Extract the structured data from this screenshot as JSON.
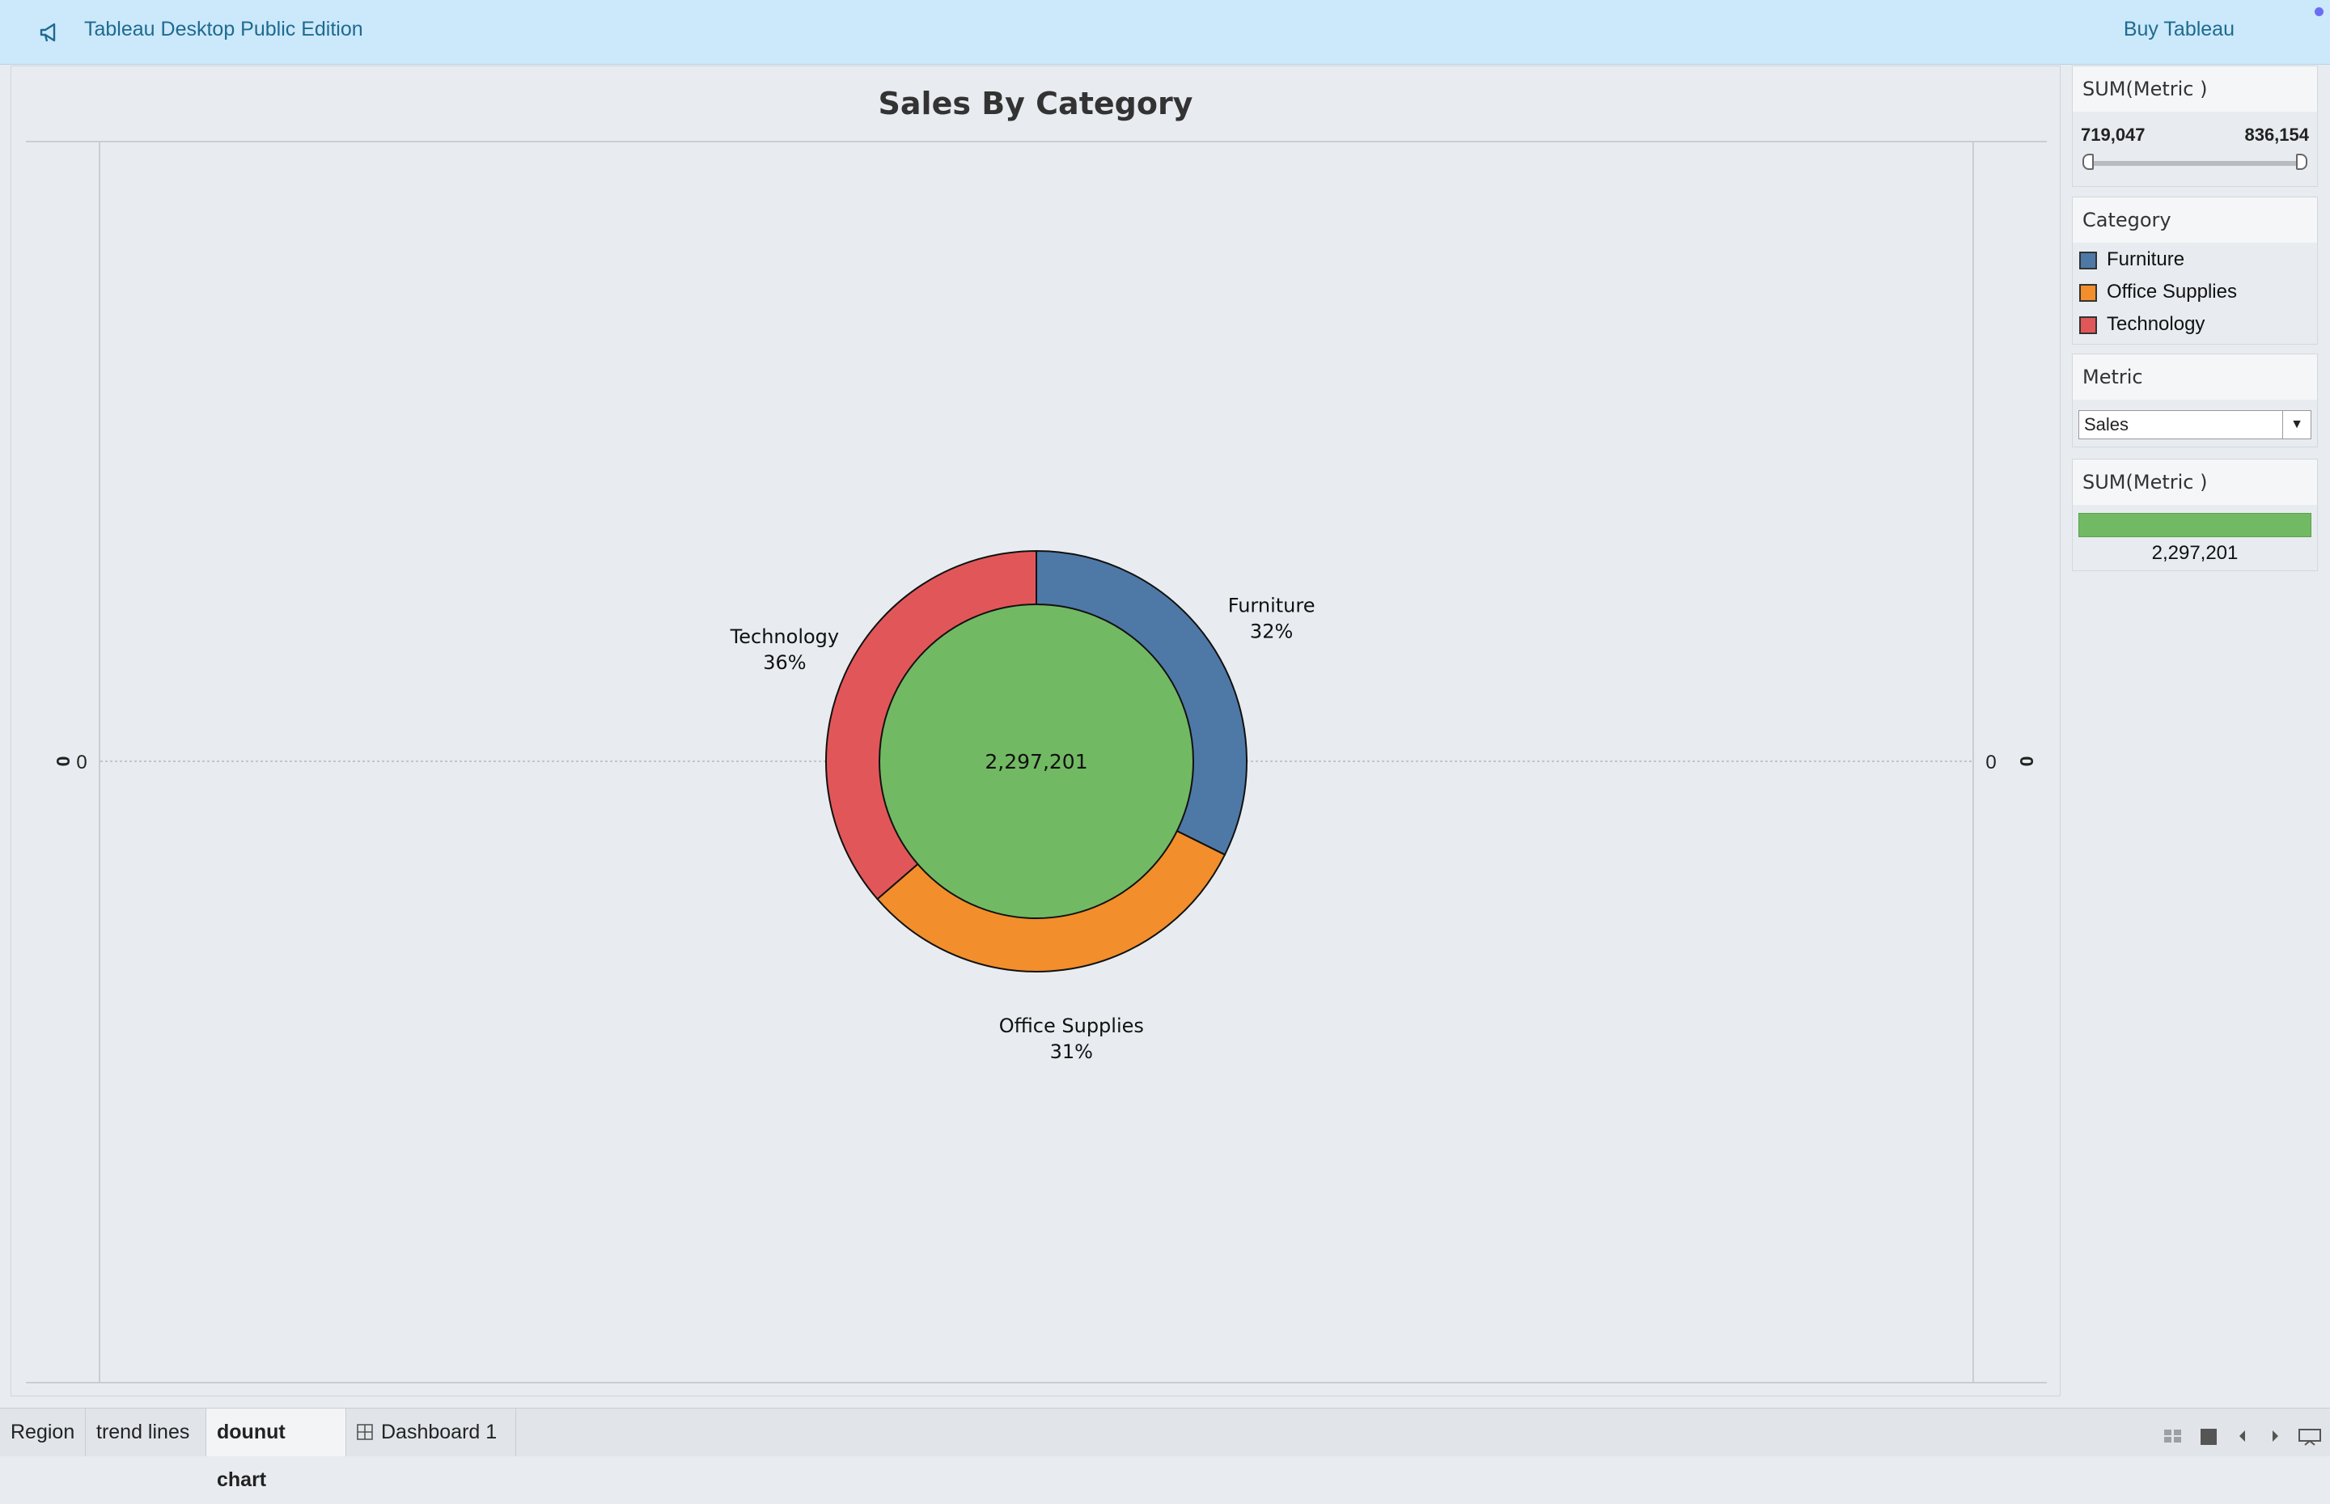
{
  "banner": {
    "app_title": "Tableau Desktop Public Edition",
    "buy_label": "Buy Tableau",
    "icon": "megaphone-icon"
  },
  "chart_title": "Sales By Category",
  "axis_labels": {
    "left_rot": "0",
    "left_val": "0",
    "right_val": "0",
    "right_rot": "0"
  },
  "chart_data": {
    "type": "pie",
    "title": "Sales By Category",
    "total_label": "2,297,201",
    "categories": [
      "Furniture",
      "Office Supplies",
      "Technology"
    ],
    "values": [
      32,
      31,
      36
    ],
    "percent_labels": [
      "32%",
      "31%",
      "36%"
    ],
    "colors": [
      "#4e79a7",
      "#f28e2b",
      "#e15759"
    ],
    "center_color": "#72b963"
  },
  "panel": {
    "range": {
      "header": "SUM(Metric )",
      "min": "719,047",
      "max": "836,154"
    },
    "legend": {
      "header": "Category",
      "items": [
        {
          "label": "Furniture",
          "color": "#4e79a7"
        },
        {
          "label": "Office Supplies",
          "color": "#f28e2b"
        },
        {
          "label": "Technology",
          "color": "#e15759"
        }
      ]
    },
    "metric": {
      "header": "Metric",
      "selected": "Sales"
    },
    "sum": {
      "header": "SUM(Metric )",
      "value": "2,297,201",
      "color": "#72b963"
    }
  },
  "tabs": [
    {
      "label": "Region",
      "active": false
    },
    {
      "label": "trend lines",
      "active": false
    },
    {
      "label": "dounut chart",
      "active": true
    },
    {
      "label": "Dashboard 1",
      "active": false,
      "icon": "dashboard-grid-icon"
    }
  ]
}
